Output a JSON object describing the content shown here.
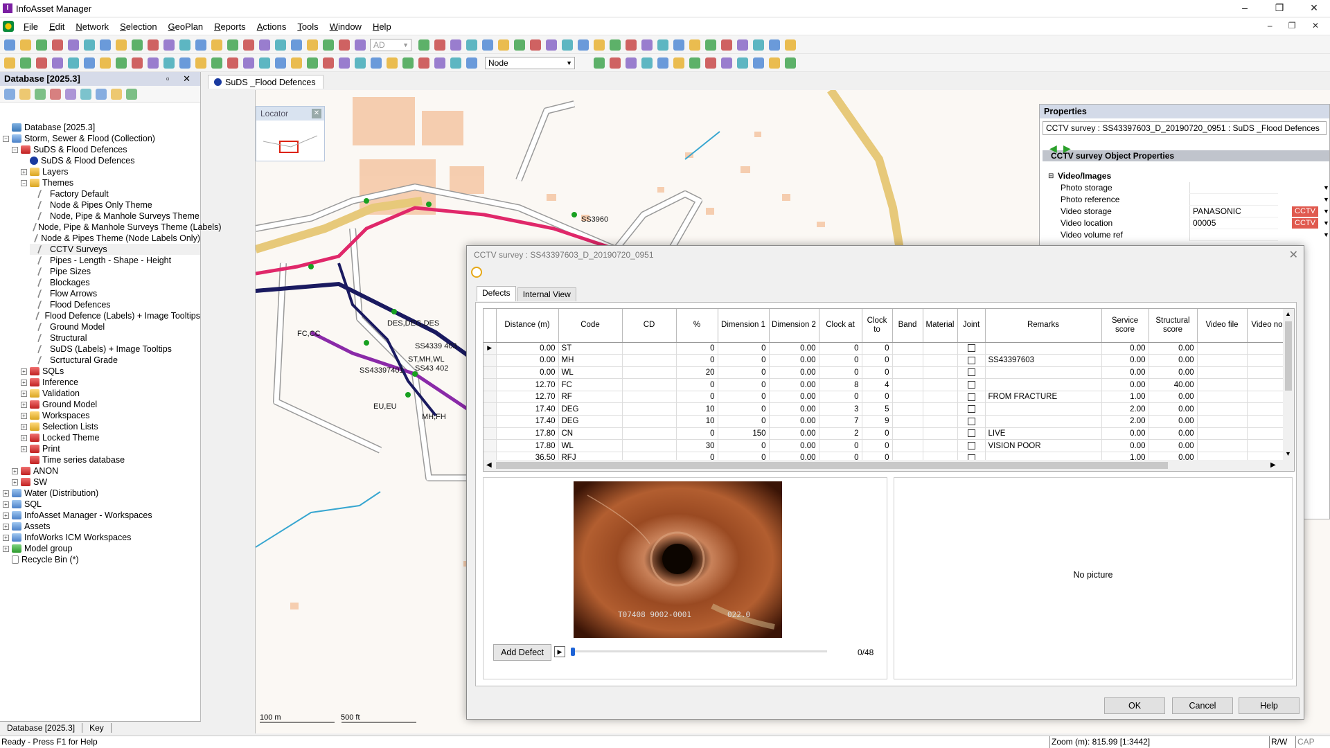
{
  "window": {
    "title": "InfoAsset Manager",
    "controls": [
      "–",
      "❐",
      "✕"
    ]
  },
  "menu": [
    "File",
    "Edit",
    "Network",
    "Selection",
    "GeoPlan",
    "Reports",
    "Actions",
    "Tools",
    "Window",
    "Help"
  ],
  "toolbar": {
    "dropdown1": "AD",
    "object_type": "Node"
  },
  "database_panel": {
    "title": "Database [2025.3]",
    "tree": [
      {
        "label": "Database [2025.3]",
        "level": 0,
        "icon": "database-icon",
        "expander": "",
        "icon_class": "ico-db"
      },
      {
        "label": "Storm, Sewer & Flood (Collection)",
        "level": 0,
        "icon": "collection-network-icon",
        "expander": "−",
        "icon_class": "ico-blue"
      },
      {
        "label": "SuDS & Flood Defences",
        "level": 1,
        "icon": "network-icon",
        "expander": "−",
        "icon_class": "ico-red"
      },
      {
        "label": "SuDS & Flood Defences",
        "level": 2,
        "icon": "network-ball-icon",
        "expander": "",
        "icon_class": "ico-ball"
      },
      {
        "label": "Layers",
        "level": 2,
        "icon": "folder-icon",
        "expander": "+",
        "icon_class": "ico-folder"
      },
      {
        "label": "Themes",
        "level": 2,
        "icon": "folder-icon",
        "expander": "−",
        "icon_class": "ico-folder"
      },
      {
        "label": "Factory Default",
        "level": 3,
        "icon": "theme-icon",
        "expander": "",
        "icon_class": "ico-theme"
      },
      {
        "label": "Node & Pipes Only Theme",
        "level": 3,
        "icon": "theme-icon",
        "expander": "",
        "icon_class": "ico-theme"
      },
      {
        "label": "Node, Pipe & Manhole Surveys Theme",
        "level": 3,
        "icon": "theme-icon",
        "expander": "",
        "icon_class": "ico-theme"
      },
      {
        "label": "Node, Pipe & Manhole Surveys Theme (Labels)",
        "level": 3,
        "icon": "theme-icon",
        "expander": "",
        "icon_class": "ico-theme"
      },
      {
        "label": "Node & Pipes Theme (Node Labels Only)",
        "level": 3,
        "icon": "theme-icon",
        "expander": "",
        "icon_class": "ico-theme"
      },
      {
        "label": "CCTV Surveys",
        "level": 3,
        "icon": "theme-icon",
        "expander": "",
        "icon_class": "ico-theme",
        "selected": true
      },
      {
        "label": "Pipes - Length - Shape - Height",
        "level": 3,
        "icon": "theme-icon",
        "expander": "",
        "icon_class": "ico-theme"
      },
      {
        "label": "Pipe Sizes",
        "level": 3,
        "icon": "theme-icon",
        "expander": "",
        "icon_class": "ico-theme"
      },
      {
        "label": "Blockages",
        "level": 3,
        "icon": "theme-icon",
        "expander": "",
        "icon_class": "ico-theme"
      },
      {
        "label": "Flow Arrows",
        "level": 3,
        "icon": "theme-icon",
        "expander": "",
        "icon_class": "ico-theme"
      },
      {
        "label": "Flood Defences",
        "level": 3,
        "icon": "theme-icon",
        "expander": "",
        "icon_class": "ico-theme"
      },
      {
        "label": "Flood Defence (Labels) + Image Tooltips",
        "level": 3,
        "icon": "theme-icon",
        "expander": "",
        "icon_class": "ico-theme"
      },
      {
        "label": "Ground Model",
        "level": 3,
        "icon": "theme-icon",
        "expander": "",
        "icon_class": "ico-theme"
      },
      {
        "label": "Structural",
        "level": 3,
        "icon": "theme-icon",
        "expander": "",
        "icon_class": "ico-theme"
      },
      {
        "label": "SuDS (Labels) + Image Tooltips",
        "level": 3,
        "icon": "theme-icon",
        "expander": "",
        "icon_class": "ico-theme"
      },
      {
        "label": "Scrtuctural Grade",
        "level": 3,
        "icon": "theme-icon",
        "expander": "",
        "icon_class": "ico-theme"
      },
      {
        "label": "SQLs",
        "level": 2,
        "icon": "sql-icon",
        "expander": "+",
        "icon_class": "ico-red"
      },
      {
        "label": "Inference",
        "level": 2,
        "icon": "inference-icon",
        "expander": "+",
        "icon_class": "ico-red"
      },
      {
        "label": "Validation",
        "level": 2,
        "icon": "validation-icon",
        "expander": "+",
        "icon_class": "ico-folder"
      },
      {
        "label": "Ground Model",
        "level": 2,
        "icon": "ground-model-icon",
        "expander": "+",
        "icon_class": "ico-red"
      },
      {
        "label": "Workspaces",
        "level": 2,
        "icon": "workspace-icon",
        "expander": "+",
        "icon_class": "ico-folder"
      },
      {
        "label": "Selection Lists",
        "level": 2,
        "icon": "selection-list-icon",
        "expander": "+",
        "icon_class": "ico-folder"
      },
      {
        "label": "Locked Theme",
        "level": 2,
        "icon": "locked-theme-icon",
        "expander": "+",
        "icon_class": "ico-red"
      },
      {
        "label": "Print",
        "level": 2,
        "icon": "print-icon",
        "expander": "+",
        "icon_class": "ico-red"
      },
      {
        "label": "Time series database",
        "level": 2,
        "icon": "time-series-icon",
        "expander": "",
        "icon_class": "ico-red"
      },
      {
        "label": "ANON",
        "level": 1,
        "icon": "network-icon",
        "expander": "+",
        "icon_class": "ico-red"
      },
      {
        "label": "SW",
        "level": 1,
        "icon": "network-icon",
        "expander": "+",
        "icon_class": "ico-red"
      },
      {
        "label": "Water (Distribution)",
        "level": 0,
        "icon": "collection-network-icon",
        "expander": "+",
        "icon_class": "ico-blue"
      },
      {
        "label": "SQL",
        "level": 0,
        "icon": "collection-network-icon",
        "expander": "+",
        "icon_class": "ico-blue"
      },
      {
        "label": "InfoAsset Manager - Workspaces",
        "level": 0,
        "icon": "collection-network-icon",
        "expander": "+",
        "icon_class": "ico-blue"
      },
      {
        "label": "Assets",
        "level": 0,
        "icon": "collection-network-icon",
        "expander": "+",
        "icon_class": "ico-blue"
      },
      {
        "label": "InfoWorks ICM Workspaces",
        "level": 0,
        "icon": "collection-network-icon",
        "expander": "+",
        "icon_class": "ico-blue"
      },
      {
        "label": "Model group",
        "level": 0,
        "icon": "model-group-icon",
        "expander": "+",
        "icon_class": "ico-green"
      },
      {
        "label": "Recycle Bin (*)",
        "level": 0,
        "icon": "recycle-bin-icon",
        "expander": "",
        "icon_class": "ico-bin"
      }
    ],
    "tabs": [
      "Database [2025.3]",
      "Key"
    ]
  },
  "document_tab": "SuDS _Flood Defences",
  "locator": {
    "title": "Locator"
  },
  "map": {
    "scale_labels": [
      "100 m",
      "500 ft"
    ],
    "labels": [
      "SS4339 403",
      "SS43397401",
      "SS43 402",
      "ST,MH,WL",
      "DES,DEG,DES",
      "MH,FH",
      "SS3960",
      "FC,CC",
      "EU,EU"
    ]
  },
  "properties": {
    "title": "Properties",
    "object": "CCTV survey : SS43397603_D_20190720_0951 : SuDS _Flood Defences",
    "section": "CCTV survey Object Properties",
    "group": "Video/Images",
    "rows": [
      {
        "label": "Photo storage",
        "value": "",
        "flag": ""
      },
      {
        "label": "Photo reference",
        "value": "",
        "flag": ""
      },
      {
        "label": "Video storage",
        "value": "PANASONIC",
        "flag": "CCTV"
      },
      {
        "label": "Video location",
        "value": "00005",
        "flag": "CCTV"
      },
      {
        "label": "Video volume ref",
        "value": "",
        "flag": ""
      }
    ],
    "flag_color": "#e05a4f"
  },
  "dialog": {
    "title": "CCTV survey : SS43397603_D_20190720_0951",
    "tabs": [
      "Defects",
      "Internal View"
    ],
    "active_tab": "Defects",
    "columns": [
      "Distance (m)",
      "Code",
      "CD",
      "%",
      "Dimension 1",
      "Dimension 2",
      "Clock at",
      "Clock to",
      "Band",
      "Material",
      "Joint",
      "Remarks",
      "Service score",
      "Structural score",
      "Video file",
      "Video no"
    ],
    "rows": [
      {
        "distance": "0.00",
        "code": "ST",
        "cd": "",
        "pct": "0",
        "dim1": "0",
        "dim2": "0.00",
        "clock_at": "0",
        "clock_to": "0",
        "band": "",
        "material": "",
        "joint": false,
        "remarks": "",
        "service": "0.00",
        "structural": "0.00",
        "video_file": "",
        "video_no": "",
        "current": true
      },
      {
        "distance": "0.00",
        "code": "MH",
        "cd": "",
        "pct": "0",
        "dim1": "0",
        "dim2": "0.00",
        "clock_at": "0",
        "clock_to": "0",
        "band": "",
        "material": "",
        "joint": false,
        "remarks": "SS43397603",
        "service": "0.00",
        "structural": "0.00",
        "video_file": "",
        "video_no": ""
      },
      {
        "distance": "0.00",
        "code": "WL",
        "cd": "",
        "pct": "20",
        "dim1": "0",
        "dim2": "0.00",
        "clock_at": "0",
        "clock_to": "0",
        "band": "",
        "material": "",
        "joint": false,
        "remarks": "",
        "service": "0.00",
        "structural": "0.00",
        "video_file": "",
        "video_no": ""
      },
      {
        "distance": "12.70",
        "code": "FC",
        "cd": "",
        "pct": "0",
        "dim1": "0",
        "dim2": "0.00",
        "clock_at": "8",
        "clock_to": "4",
        "band": "",
        "material": "",
        "joint": false,
        "remarks": "",
        "service": "0.00",
        "structural": "40.00",
        "video_file": "",
        "video_no": ""
      },
      {
        "distance": "12.70",
        "code": "RF",
        "cd": "",
        "pct": "0",
        "dim1": "0",
        "dim2": "0.00",
        "clock_at": "0",
        "clock_to": "0",
        "band": "",
        "material": "",
        "joint": false,
        "remarks": "FROM FRACTURE",
        "service": "1.00",
        "structural": "0.00",
        "video_file": "",
        "video_no": ""
      },
      {
        "distance": "17.40",
        "code": "DEG",
        "cd": "",
        "pct": "10",
        "dim1": "0",
        "dim2": "0.00",
        "clock_at": "3",
        "clock_to": "5",
        "band": "",
        "material": "",
        "joint": false,
        "remarks": "",
        "service": "2.00",
        "structural": "0.00",
        "video_file": "",
        "video_no": ""
      },
      {
        "distance": "17.40",
        "code": "DEG",
        "cd": "",
        "pct": "10",
        "dim1": "0",
        "dim2": "0.00",
        "clock_at": "7",
        "clock_to": "9",
        "band": "",
        "material": "",
        "joint": false,
        "remarks": "",
        "service": "2.00",
        "structural": "0.00",
        "video_file": "",
        "video_no": ""
      },
      {
        "distance": "17.80",
        "code": "CN",
        "cd": "",
        "pct": "0",
        "dim1": "150",
        "dim2": "0.00",
        "clock_at": "2",
        "clock_to": "0",
        "band": "",
        "material": "",
        "joint": false,
        "remarks": "LIVE",
        "service": "0.00",
        "structural": "0.00",
        "video_file": "",
        "video_no": ""
      },
      {
        "distance": "17.80",
        "code": "WL",
        "cd": "",
        "pct": "30",
        "dim1": "0",
        "dim2": "0.00",
        "clock_at": "0",
        "clock_to": "0",
        "band": "",
        "material": "",
        "joint": false,
        "remarks": "VISION POOR",
        "service": "0.00",
        "structural": "0.00",
        "video_file": "",
        "video_no": ""
      },
      {
        "distance": "36.50",
        "code": "RFJ",
        "cd": "",
        "pct": "0",
        "dim1": "0",
        "dim2": "0.00",
        "clock_at": "0",
        "clock_to": "0",
        "band": "",
        "material": "",
        "joint": false,
        "remarks": "",
        "service": "1.00",
        "structural": "0.00",
        "video_file": "",
        "video_no": ""
      }
    ],
    "video": {
      "stamp_left": "T07408 9002-0001",
      "stamp_right": "022.0",
      "add_defect_label": "Add Defect",
      "frame_counter": "0/48",
      "progress_fraction": 0
    },
    "no_picture": "No picture",
    "buttons": {
      "ok": "OK",
      "cancel": "Cancel",
      "help": "Help"
    }
  },
  "statusbar": {
    "text": "Ready - Press F1 for Help",
    "zoom": "Zoom (m): 815.99 [1:3442]",
    "mode": "R/W",
    "caps": "CAP"
  }
}
